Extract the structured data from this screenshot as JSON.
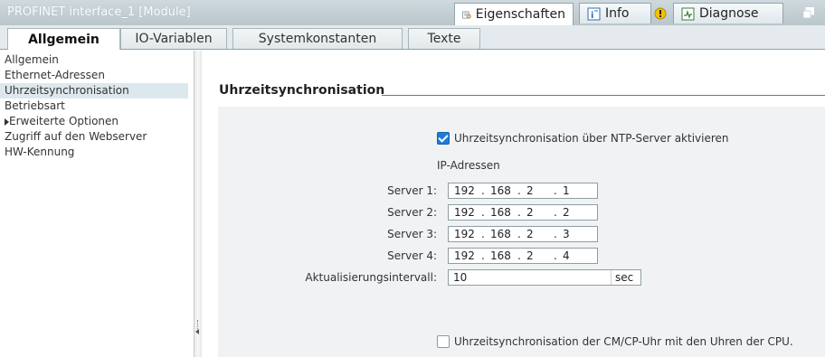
{
  "window": {
    "title": "PROFINET interface_1 [Module]",
    "top_tabs": [
      {
        "label": "Eigenschaften",
        "icon": "properties-icon"
      },
      {
        "label": "Info",
        "icon": "info-icon"
      },
      {
        "label": "Diagnose",
        "icon": "diagnostics-icon"
      }
    ]
  },
  "tabs": [
    "Allgemein",
    "IO-Variablen",
    "Systemkonstanten",
    "Texte"
  ],
  "nav": {
    "items": [
      "Allgemein",
      "Ethernet-Adressen",
      "Uhrzeitsynchronisation",
      "Betriebsart",
      "Erweiterte Optionen",
      "Zugriff auf den Webserver",
      "HW-Kennung"
    ],
    "selected_index": 2
  },
  "section": {
    "title": "Uhrzeitsynchronisation",
    "ntp_checkbox_label": "Uhrzeitsynchronisation über NTP-Server aktivieren",
    "ntp_checked": true,
    "ip_header": "IP-Adressen",
    "servers": [
      {
        "label": "Server 1:",
        "octets": [
          "192",
          "168",
          "2",
          "1"
        ]
      },
      {
        "label": "Server 2:",
        "octets": [
          "192",
          "168",
          "2",
          "2"
        ]
      },
      {
        "label": "Server 3:",
        "octets": [
          "192",
          "168",
          "2",
          "3"
        ]
      },
      {
        "label": "Server 4:",
        "octets": [
          "192",
          "168",
          "2",
          "4"
        ]
      }
    ],
    "interval_label": "Aktualisierungsintervall:",
    "interval_value": "10",
    "interval_unit": "sec",
    "cpu_checkbox_label": "Uhrzeitsynchronisation der CM/CP-Uhr mit den Uhren der CPU.",
    "cpu_checked": false
  },
  "colors": {
    "accent": "#1e7ad6",
    "titlebar": "#c4d0d5",
    "panel": "#f0f2f3"
  }
}
